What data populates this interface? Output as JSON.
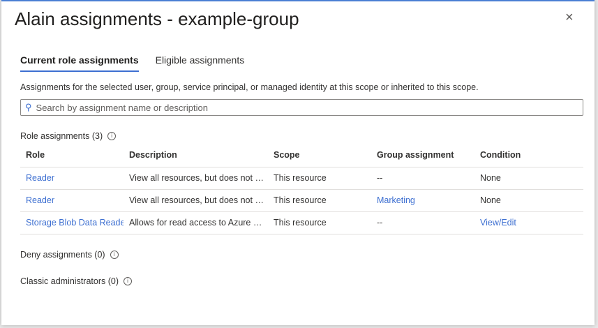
{
  "dialog": {
    "title": "Alain assignments - example-group",
    "close_icon": "×"
  },
  "tabs": [
    {
      "label": "Current role assignments",
      "active": true
    },
    {
      "label": "Eligible assignments",
      "active": false
    }
  ],
  "description": "Assignments for the selected user, group, service principal, or managed identity at this scope or inherited to this scope.",
  "search": {
    "placeholder": "Search by assignment name or description",
    "value": ""
  },
  "role_assignments": {
    "label": "Role assignments (3)",
    "columns": [
      "Role",
      "Description",
      "Scope",
      "Group assignment",
      "Condition"
    ],
    "rows": [
      {
        "role": "Reader",
        "description": "View all resources, but does not allow you to make any changes.",
        "scope": "This resource",
        "group": "--",
        "condition": "None"
      },
      {
        "role": "Reader",
        "description": "View all resources, but does not allow you to make any changes.",
        "scope": "This resource",
        "group": "Marketing",
        "condition": "None"
      },
      {
        "role": "Storage Blob Data Reader",
        "description": "Allows for read access to Azure Storage blob containers and data",
        "scope": "This resource",
        "group": "--",
        "condition": "View/Edit"
      }
    ]
  },
  "deny_assignments": {
    "label": "Deny assignments (0)"
  },
  "classic_admins": {
    "label": "Classic administrators (0)"
  },
  "colors": {
    "accent": "#3d6fd1"
  }
}
